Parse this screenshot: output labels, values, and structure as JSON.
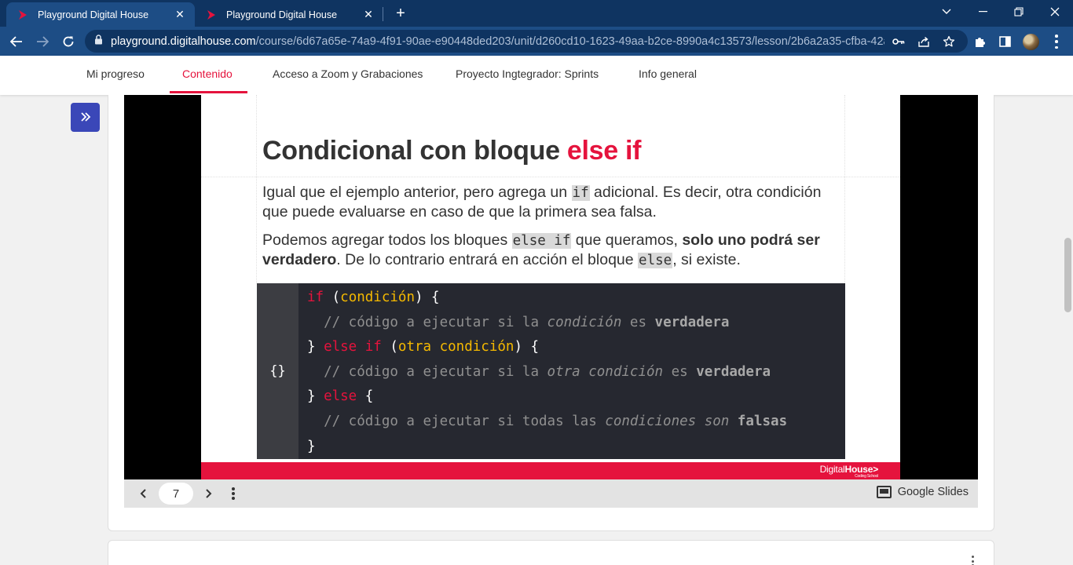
{
  "browser": {
    "tabs": [
      {
        "title": "Playground Digital House",
        "active": true
      },
      {
        "title": "Playground Digital House",
        "active": false
      }
    ],
    "url_host": "playground.digitalhouse.com",
    "url_path": "/course/6d67a65e-74a9-4f91-90ae-e90448ded203/unit/d260cd10-1623-49aa-b2ce-8990a4c13573/lesson/2b6a2a35-cfba-42a4-...",
    "colors": {
      "tabbar": "#0f3461",
      "toolbar": "#1d4d85"
    }
  },
  "site_nav": {
    "items": [
      {
        "label": "Mi progreso",
        "active": false
      },
      {
        "label": "Contenido",
        "active": true
      },
      {
        "label": "Acceso a Zoom y Grabaciones",
        "active": false
      },
      {
        "label": "Proyecto Ingtegrador: Sprints",
        "active": false
      },
      {
        "label": "Info general",
        "active": false
      }
    ],
    "accent": "#e5133d"
  },
  "sidebar": {
    "expand_icon": "double-chevron-right-icon"
  },
  "slide": {
    "title_main": "Condicional con bloque ",
    "title_highlight": "else if",
    "para1": {
      "t1": "Igual que el ejemplo anterior, pero agrega un ",
      "code": "if",
      "t2": " adicional. Es decir, otra condición que puede evaluarse en caso de que la primera sea falsa."
    },
    "para2": {
      "t1": "Podemos agregar todos los bloques ",
      "code1": "else if",
      "t2": " que queramos, ",
      "bold": "solo uno podrá ser verdadero",
      "t3": ". De lo contrario entrará en acción el bloque ",
      "code2": "else",
      "t4": ", si existe."
    },
    "code": {
      "gutter_label": "{}",
      "l1": {
        "kw": "if",
        "p1": " (",
        "cond": "condición",
        "p2": ") {"
      },
      "l2": {
        "t1": "  // código a ejecutar si la ",
        "em": "condición",
        "t2": " es ",
        "strong": "verdadera"
      },
      "l3": {
        "p0": "} ",
        "kw": "else if",
        "p1": " (",
        "cond": "otra condición",
        "p2": ") {"
      },
      "l4": {
        "t1": "  // código a ejecutar si la ",
        "em": "otra condición",
        "t2": " es ",
        "strong": "verdadera"
      },
      "l5": {
        "p0": "} ",
        "kw": "else",
        "p1": " {"
      },
      "l6": {
        "t1": "  // código a ejecutar si todas las ",
        "em": "condiciones son",
        "t2": " ",
        "strong": "falsas"
      },
      "l7": {
        "p0": "}"
      }
    },
    "footer_logo": {
      "light": "Digital",
      "bold": "House>",
      "sub": "Coding School"
    }
  },
  "slides_toolbar": {
    "page": "7",
    "brand": "Google Slides"
  }
}
